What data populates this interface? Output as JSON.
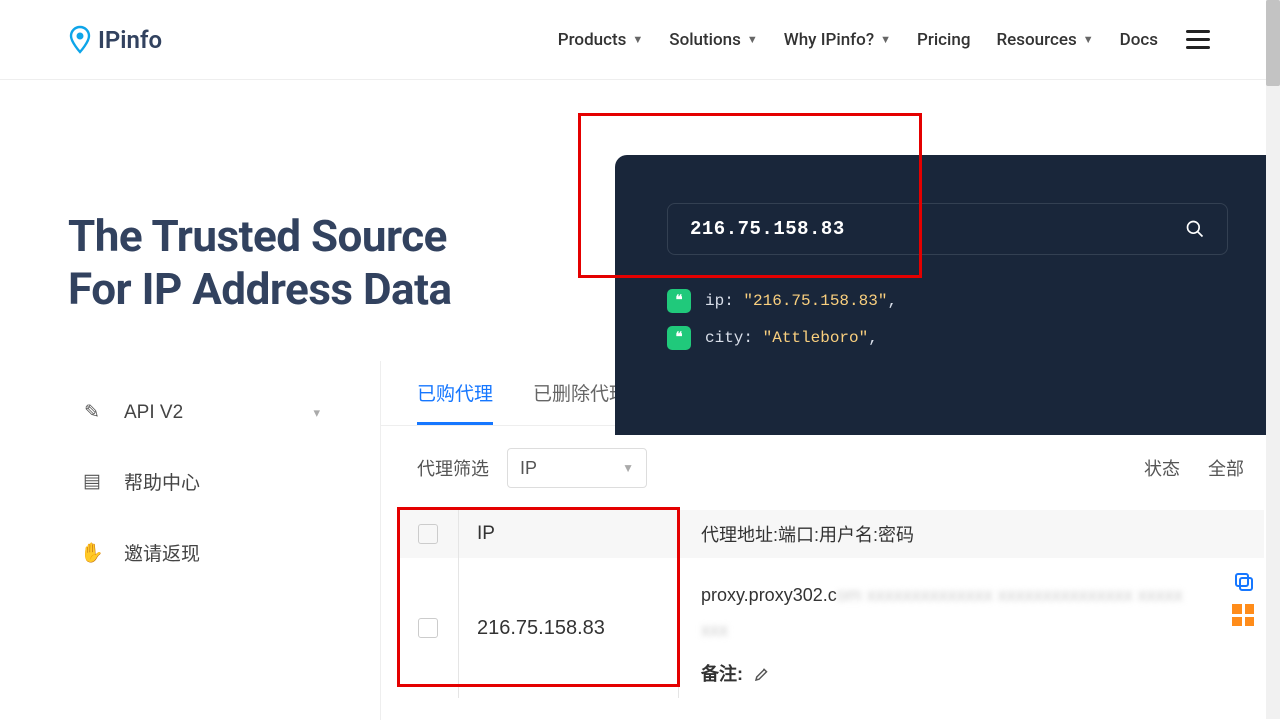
{
  "ipinfo": {
    "brand": "IPinfo",
    "nav": {
      "products": "Products",
      "solutions": "Solutions",
      "why": "Why IPinfo?",
      "pricing": "Pricing",
      "resources": "Resources",
      "docs": "Docs"
    },
    "headline_l1": "The Trusted Source",
    "headline_l2": "For IP Address Data",
    "search_value": "216.75.158.83",
    "json": {
      "ip_key": "ip",
      "ip_val": "\"216.75.158.83\"",
      "city_key": "city",
      "city_val": "\"Attleboro\"",
      "comma": ","
    }
  },
  "dash": {
    "sidebar": {
      "api": "API V2",
      "help": "帮助中心",
      "invite": "邀请返现"
    },
    "tabs": {
      "purchased": "已购代理",
      "deleted": "已删除代理"
    },
    "filter": {
      "label": "代理筛选",
      "select_value": "IP",
      "status_label": "状态",
      "status_value": "全部"
    },
    "table": {
      "head_ip": "IP",
      "head_addr": "代理地址:端口:用户名:密码",
      "row_ip": "216.75.158.83",
      "row_addr_prefix": "proxy.proxy302.c",
      "row_addr_blur": "om  xxxxxxxxxxxxxx  xxxxxxxxxxxxxxx xxxxx",
      "note_label": "备注:"
    }
  }
}
